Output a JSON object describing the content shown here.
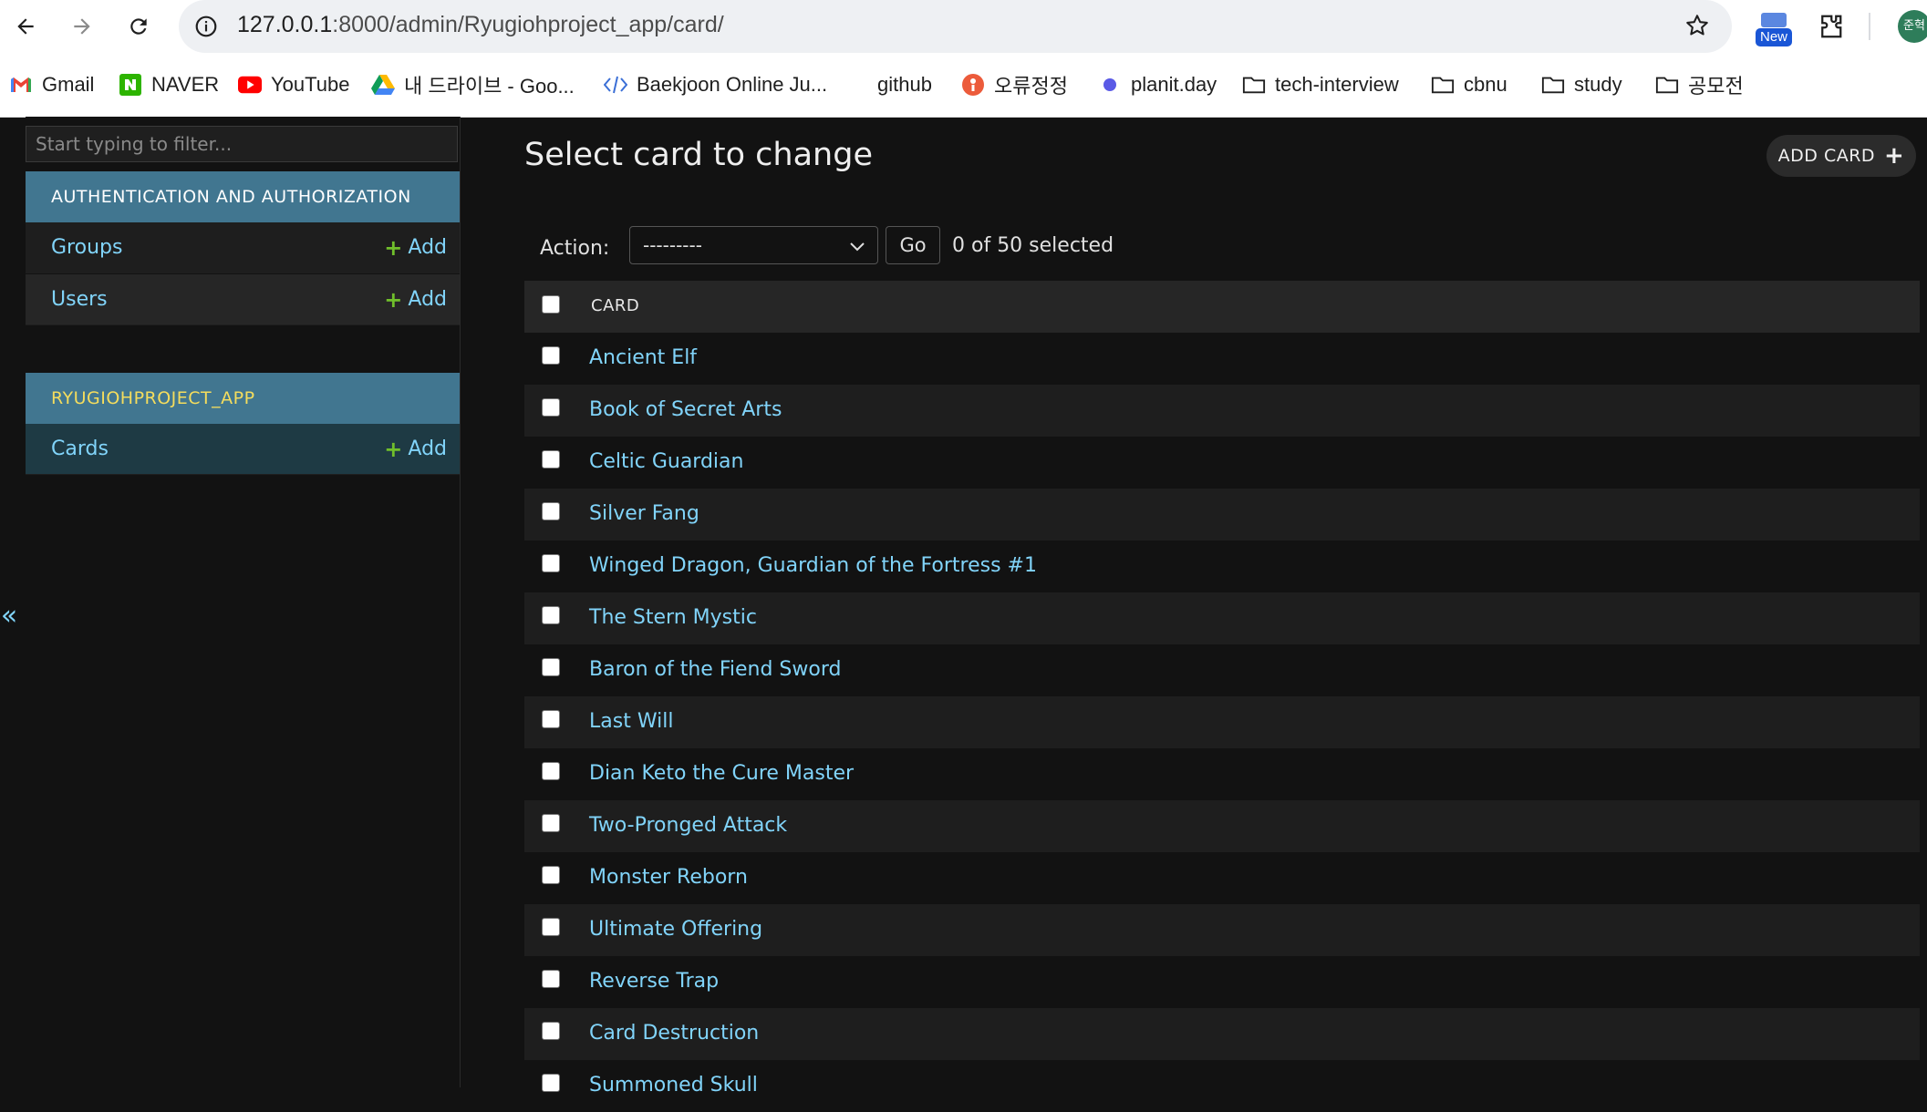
{
  "browser": {
    "url_host": "127.0.0.1",
    "url_rest": ":8000/admin/Ryugiohproject_app/card/",
    "new_badge": "New",
    "profile_initials": "준혁"
  },
  "bookmarks": [
    {
      "label": "Gmail",
      "icon": "gmail-icon"
    },
    {
      "label": "NAVER",
      "icon": "naver-icon"
    },
    {
      "label": "YouTube",
      "icon": "youtube-icon"
    },
    {
      "label": "내 드라이브 - Goo...",
      "icon": "google-drive-icon"
    },
    {
      "label": "Baekjoon Online Ju...",
      "icon": "code-icon"
    },
    {
      "label": "github",
      "icon": "github-icon"
    },
    {
      "label": "오류정정",
      "icon": "orange-circle-icon"
    },
    {
      "label": "planit.day",
      "icon": "planit-icon"
    },
    {
      "label": "tech-interview",
      "icon": "folder-icon"
    },
    {
      "label": "cbnu",
      "icon": "folder-icon"
    },
    {
      "label": "study",
      "icon": "folder-icon"
    },
    {
      "label": "공모전",
      "icon": "folder-icon"
    }
  ],
  "sidebar": {
    "filter_placeholder": "Start typing to filter...",
    "collapse_glyph": "«",
    "auth_module": {
      "title": "AUTHENTICATION AND AUTHORIZATION",
      "models": [
        {
          "name": "Groups",
          "add": "Add"
        },
        {
          "name": "Users",
          "add": "Add"
        }
      ]
    },
    "app_module": {
      "title": "RYUGIOHPROJECT_APP",
      "models": [
        {
          "name": "Cards",
          "add": "Add"
        }
      ]
    }
  },
  "main": {
    "title": "Select card to change",
    "add_button": "ADD CARD",
    "action_label": "Action:",
    "action_value": "---------",
    "go_label": "Go",
    "selection_counter": "0 of 50 selected",
    "column_header": "CARD",
    "rows": [
      "Ancient Elf",
      "Book of Secret Arts",
      "Celtic Guardian",
      "Silver Fang",
      "Winged Dragon, Guardian of the Fortress #1",
      "The Stern Mystic",
      "Baron of the Fiend Sword",
      "Last Will",
      "Dian Keto the Cure Master",
      "Two-Pronged Attack",
      "Monster Reborn",
      "Ultimate Offering",
      "Reverse Trap",
      "Card Destruction",
      "Summoned Skull"
    ]
  },
  "colors": {
    "header_blue": "#417690",
    "link_blue": "#81d4fa",
    "app_title_yellow": "#f5dd5d",
    "add_plus_green": "#70bf2b",
    "background": "#121212"
  }
}
